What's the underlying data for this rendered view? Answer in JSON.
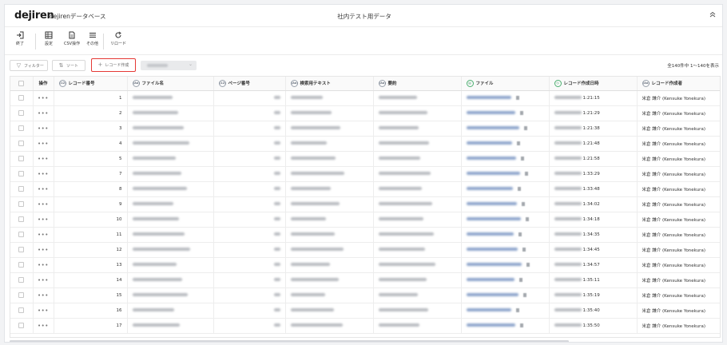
{
  "header": {
    "logo": "dejiren",
    "app_name": "dejirenデータベース",
    "title": "社内テスト用データ",
    "collapse_icon": "chevrons-up-icon"
  },
  "toolbar": {
    "exit": "終了",
    "settings": "設定",
    "csv": "CSV操作",
    "other": "その他",
    "reload": "リロード"
  },
  "controls": {
    "filter": "フィルター",
    "sort": "ソート",
    "create": "レコード作成",
    "record_count": "全140件中 1～140を表示"
  },
  "columns": {
    "op": "操作",
    "record_no": "レコード番号",
    "filename": "ファイル名",
    "page_no": "ページ番号",
    "search_text": "検索用テキスト",
    "summary": "要約",
    "file": "ファイル",
    "created_at": "レコード作成日時",
    "creator": "レコード作成者"
  },
  "column_type_icons": {
    "record_no": "(12)",
    "filename": "(Aa)",
    "page_no": "(12)",
    "search_text": "(Aa)",
    "summary": "(Aa)",
    "file": "file-icon",
    "created_at": "clock-icon",
    "creator": "(Aa)"
  },
  "rows": [
    {
      "no": "1",
      "time": "1:21:15",
      "creator": "米倉 謙介 (Kensuke Yonekura)"
    },
    {
      "no": "2",
      "time": "1:21:29",
      "creator": "米倉 謙介 (Kensuke Yonekura)"
    },
    {
      "no": "3",
      "time": "1:21:38",
      "creator": "米倉 謙介 (Kensuke Yonekura)"
    },
    {
      "no": "4",
      "time": "1:21:48",
      "creator": "米倉 謙介 (Kensuke Yonekura)"
    },
    {
      "no": "5",
      "time": "1:21:58",
      "creator": "米倉 謙介 (Kensuke Yonekura)"
    },
    {
      "no": "7",
      "time": "1:33:29",
      "creator": "米倉 謙介 (Kensuke Yonekura)"
    },
    {
      "no": "8",
      "time": "1:33:48",
      "creator": "米倉 謙介 (Kensuke Yonekura)"
    },
    {
      "no": "9",
      "time": "1:34:02",
      "creator": "米倉 謙介 (Kensuke Yonekura)"
    },
    {
      "no": "10",
      "time": "1:34:18",
      "creator": "米倉 謙介 (Kensuke Yonekura)"
    },
    {
      "no": "11",
      "time": "1:34:35",
      "creator": "米倉 謙介 (Kensuke Yonekura)"
    },
    {
      "no": "12",
      "time": "1:34:45",
      "creator": "米倉 謙介 (Kensuke Yonekura)"
    },
    {
      "no": "13",
      "time": "1:34:57",
      "creator": "米倉 謙介 (Kensuke Yonekura)"
    },
    {
      "no": "14",
      "time": "1:35:11",
      "creator": "米倉 謙介 (Kensuke Yonekura)"
    },
    {
      "no": "15",
      "time": "1:35:19",
      "creator": "米倉 謙介 (Kensuke Yonekura)"
    },
    {
      "no": "16",
      "time": "1:35:40",
      "creator": "米倉 謙介 (Kensuke Yonekura)"
    },
    {
      "no": "17",
      "time": "1:35:50",
      "creator": "米倉 謙介 (Kensuke Yonekura)"
    }
  ],
  "colors": {
    "highlight": "#e53935",
    "date_icon": "#2e8b57"
  }
}
